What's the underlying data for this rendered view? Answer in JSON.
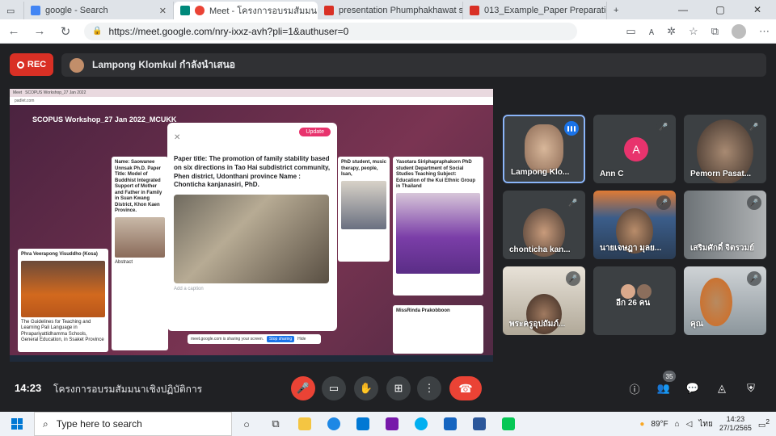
{
  "browser": {
    "tabs": [
      {
        "label": "google - Search",
        "color": "#4285f4"
      },
      {
        "label": "Meet - โครงการอบรมสัมมนาเชิ",
        "color": "#ea4335"
      },
      {
        "label": "presentation Phumphakhawat s",
        "color": "#d93025"
      },
      {
        "label": "013_Example_Paper Preparation",
        "color": "#d93025"
      }
    ],
    "url": "https://meet.google.com/nry-ixxz-avh?pli=1&authuser=0"
  },
  "meet": {
    "rec_label": "REC",
    "presenter_text": "Lampong Klomkul กำลังนำเสนอ",
    "time": "14:23",
    "meeting_name": "โครงการอบรมสัมมนาเชิงปฏิบัติการ",
    "participant_count": "35"
  },
  "shared": {
    "title": "SCOPUS Workshop_27 Jan 2022_MCUKK",
    "cards": [
      {
        "title": "Phra Veerapong Visuddho (Kosa)",
        "body": "The Guidelines for Teaching and Learning Pali Language in Phrapariyattidhamma Schools, General Education, in Ssaket Province",
        "abstract": "Abstract"
      },
      {
        "title": "Name: Saowanee Unnsak Ph.D. Paper Title: Model of Buddhist Integrated Support of Mother and Father in Family in Suan Kwang District, Khon Kaen Province.",
        "body": "Abstract"
      },
      {
        "title": "PhD student, music therapy, people, Isan,"
      },
      {
        "title": "Yasotara Siriphapraphakorn PhD student Department of Social Studies Teaching Subject: Education of the Kui Ethnic Group in Thailand"
      },
      {
        "title": "MissRinda Prakobboon"
      }
    ],
    "modal": {
      "update": "Update",
      "text": "Paper title: The promotion of family stability based on six directions in Tao Hai subdistrict community, Phen district, Udonthani province Name : Chonticha kanjanasiri, PhD.",
      "remove": "Remove",
      "caption": "Add a caption"
    },
    "share_bar": "meet.google.com is sharing your screen.",
    "stop_sharing": "Stop sharing",
    "hide": "Hide"
  },
  "participants": [
    {
      "name": "Lampong Klo...",
      "speaking": true
    },
    {
      "name": "Ann C",
      "letter": "A"
    },
    {
      "name": "Pemorn Pasat..."
    },
    {
      "name": "chonticha kan..."
    },
    {
      "name": "นายเจษฎา มุลย..."
    },
    {
      "name": "เสริมศักดิ์ จิตรวมย์"
    },
    {
      "name": "พระครูอุปถัมภ์..."
    },
    {
      "name": "อีก 26 คน"
    },
    {
      "name": "คุณ"
    }
  ],
  "taskbar": {
    "search_placeholder": "Type here to search",
    "weather": "89°F",
    "lang": "ไทย",
    "time": "14:23",
    "date": "27/1/2565",
    "notif": "2"
  }
}
